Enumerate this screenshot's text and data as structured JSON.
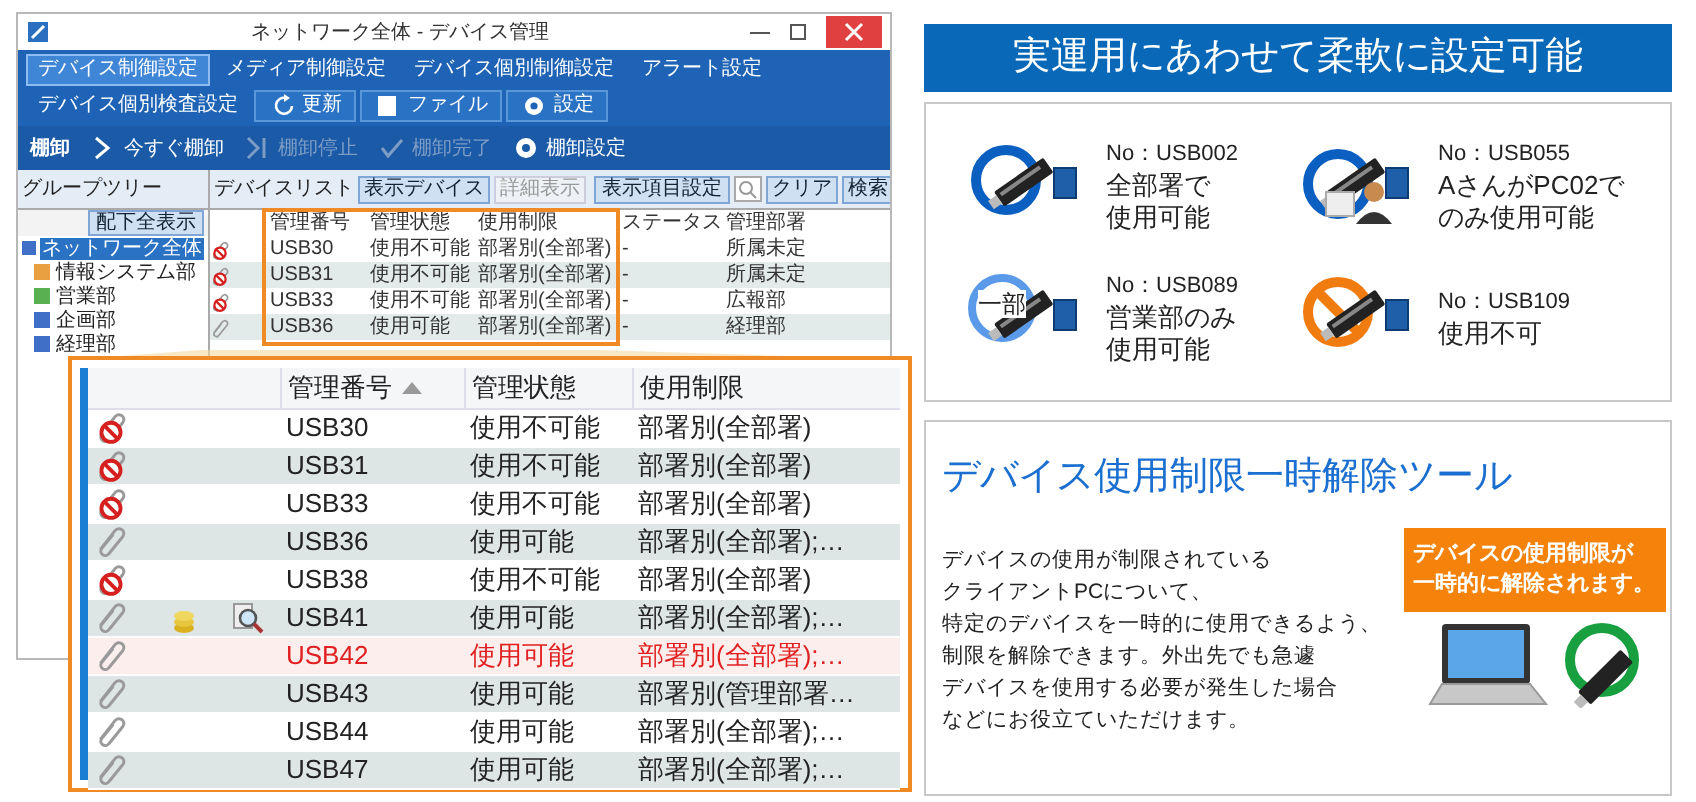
{
  "app_window": {
    "title": "ネットワーク全体 - デバイス管理",
    "tabs": [
      {
        "label": "デバイス制御設定",
        "selected": true
      },
      {
        "label": "メディア制御設定",
        "selected": false
      },
      {
        "label": "デバイス個別制御設定",
        "selected": false
      },
      {
        "label": "アラート設定",
        "selected": false
      },
      {
        "label": "デバイス個別検査設定",
        "selected": false
      }
    ],
    "tab_buttons": [
      {
        "label": "更新",
        "kind": "refresh"
      },
      {
        "label": "ファイル",
        "kind": "file"
      },
      {
        "label": "設定",
        "kind": "settings"
      }
    ],
    "toolbar_title": "棚卸",
    "toolbar": [
      {
        "label": "今すぐ棚卸",
        "kind": "start",
        "disabled": false
      },
      {
        "label": "棚卸停止",
        "kind": "stop",
        "disabled": true
      },
      {
        "label": "棚卸完了",
        "kind": "done",
        "disabled": true
      },
      {
        "label": "棚卸設定",
        "kind": "settings",
        "disabled": false
      }
    ],
    "group_tree": {
      "title": "グループツリー",
      "button": "配下全表示",
      "items": [
        {
          "label": "ネットワーク全体",
          "selected": true,
          "color": "#3f6fc6",
          "children": [
            {
              "label": "情報システム部",
              "selected": false,
              "color": "#e8a040"
            },
            {
              "label": "営業部",
              "selected": false,
              "color": "#58b050"
            },
            {
              "label": "企画部",
              "selected": false,
              "color": "#3f6fc6"
            },
            {
              "label": "経理部",
              "selected": false,
              "color": "#3f6fc6"
            }
          ]
        }
      ]
    },
    "device_list": {
      "title": "デバイスリスト",
      "tabs": [
        {
          "label": "表示デバイス",
          "selected": true
        },
        {
          "label": "詳細表示",
          "selected": false
        }
      ],
      "column_settings_button": "表示項目設定",
      "clear_button": "クリア",
      "search_button": "検索",
      "columns": [
        "管理番号",
        "管理状態",
        "使用制限",
        "ステータス",
        "管理部署"
      ],
      "rows": [
        {
          "blocked": true,
          "cells": [
            "USB30",
            "使用不可能",
            "部署別(全部署)",
            "-",
            "所属未定"
          ]
        },
        {
          "blocked": true,
          "cells": [
            "USB31",
            "使用不可能",
            "部署別(全部署)",
            "-",
            "所属未定"
          ]
        },
        {
          "blocked": true,
          "cells": [
            "USB33",
            "使用不可能",
            "部署別(全部署)",
            "-",
            "広報部"
          ]
        },
        {
          "blocked": false,
          "cells": [
            "USB36",
            "使用可能",
            "部署別(全部署)",
            "-",
            "経理部"
          ]
        }
      ]
    }
  },
  "zoomed_table": {
    "columns": [
      {
        "label": "管理番号",
        "sorted": true
      },
      {
        "label": "管理状態",
        "sorted": false
      },
      {
        "label": "使用制限",
        "sorted": false
      }
    ],
    "rows": [
      {
        "blocked": true,
        "audit": false,
        "alert": false,
        "cells": [
          "USB30",
          "使用不可能",
          "部署別(全部署)"
        ]
      },
      {
        "blocked": true,
        "audit": false,
        "alert": false,
        "cells": [
          "USB31",
          "使用不可能",
          "部署別(全部署)"
        ]
      },
      {
        "blocked": true,
        "audit": false,
        "alert": false,
        "cells": [
          "USB33",
          "使用不可能",
          "部署別(全部署)"
        ]
      },
      {
        "blocked": false,
        "audit": false,
        "alert": false,
        "cells": [
          "USB36",
          "使用可能",
          "部署別(全部署);…"
        ]
      },
      {
        "blocked": true,
        "audit": false,
        "alert": false,
        "cells": [
          "USB38",
          "使用不可能",
          "部署別(全部署)"
        ]
      },
      {
        "blocked": false,
        "audit": true,
        "alert": false,
        "cells": [
          "USB41",
          "使用可能",
          "部署別(全部署);…"
        ]
      },
      {
        "blocked": false,
        "audit": false,
        "alert": true,
        "cells": [
          "USB42",
          "使用可能",
          "部署別(全部署);…"
        ]
      },
      {
        "blocked": false,
        "audit": false,
        "alert": false,
        "cells": [
          "USB43",
          "使用可能",
          "部署別(管理部署…"
        ]
      },
      {
        "blocked": false,
        "audit": false,
        "alert": false,
        "cells": [
          "USB44",
          "使用可能",
          "部署別(全部署);…"
        ]
      },
      {
        "blocked": false,
        "audit": false,
        "alert": false,
        "cells": [
          "USB47",
          "使用可能",
          "部署別(全部署);…"
        ]
      }
    ]
  },
  "feature_banner": "実運用にあわせて柔軟に設定可能",
  "usage_examples": [
    {
      "kind": "all",
      "number": "No：USB002",
      "lines": [
        "全部署で",
        "使用可能"
      ]
    },
    {
      "kind": "user",
      "number": "No：USB055",
      "lines": [
        "AさんがPC02で",
        "のみ使用可能"
      ]
    },
    {
      "kind": "partial",
      "badge": "一部",
      "number": "No：USB089",
      "lines": [
        "営業部のみ",
        "使用可能"
      ]
    },
    {
      "kind": "blocked",
      "number": "No：USB109",
      "lines": [
        "使用不可"
      ]
    }
  ],
  "release_tool": {
    "title": "デバイス使用制限一時解除ツール",
    "description_lines": [
      "デバイスの使用が制限されている",
      "クライアントPCについて、",
      "特定のデバイスを一時的に使用できるよう、",
      "制限を解除できます。外出先でも急遽",
      "デバイスを使用する必要が発生した場合",
      "などにお役立ていただけます。"
    ],
    "callout_lines": [
      "デバイスの使用制限が",
      "一時的に解除されます。"
    ]
  }
}
